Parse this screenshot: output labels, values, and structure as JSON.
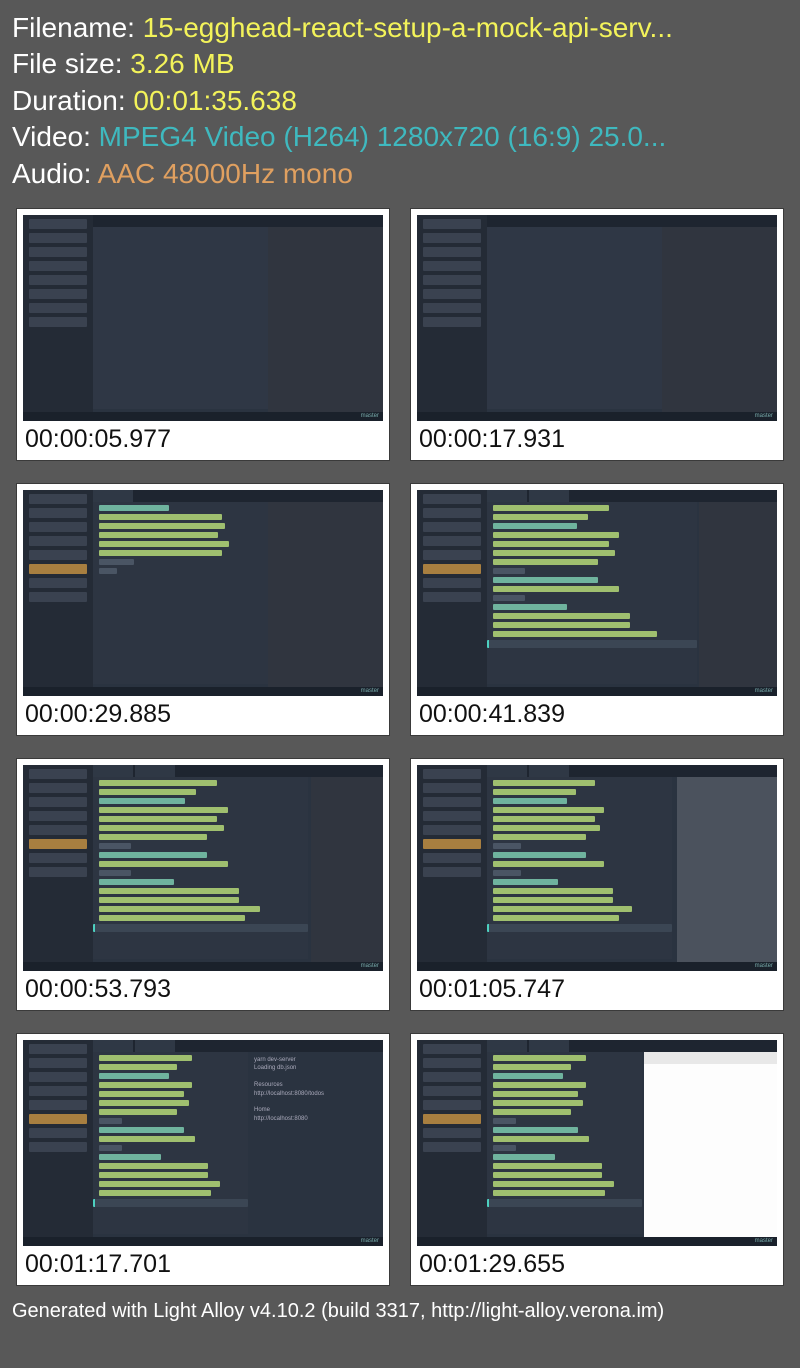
{
  "header": {
    "filename_label": "Filename: ",
    "filename_value": "15-egghead-react-setup-a-mock-api-serv...",
    "filesize_label": "File size: ",
    "filesize_value": "3.26 MB",
    "duration_label": "Duration: ",
    "duration_value": "00:01:35.638",
    "video_label": "Video: ",
    "video_value": "MPEG4 Video (H264) 1280x720 (16:9) 25.0...",
    "audio_label": "Audio: ",
    "audio_value": "AAC 48000Hz mono"
  },
  "thumbnails": [
    {
      "timestamp": "00:00:05.977"
    },
    {
      "timestamp": "00:00:17.931"
    },
    {
      "timestamp": "00:00:29.885"
    },
    {
      "timestamp": "00:00:41.839"
    },
    {
      "timestamp": "00:00:53.793"
    },
    {
      "timestamp": "00:01:05.747"
    },
    {
      "timestamp": "00:01:17.701"
    },
    {
      "timestamp": "00:01:29.655"
    }
  ],
  "footer": "Generated with Light Alloy v4.10.2 (build 3317, http://light-alloy.verona.im)"
}
